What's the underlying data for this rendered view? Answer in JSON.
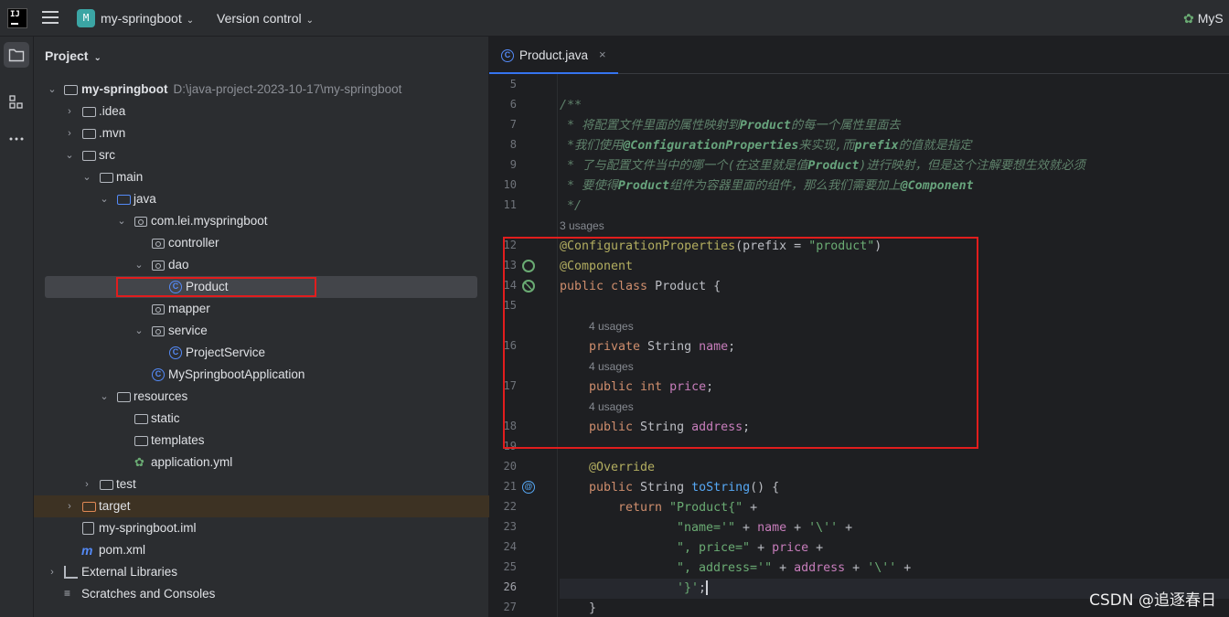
{
  "titlebar": {
    "logo": "IJ",
    "project_badge": "M",
    "project_name": "my-springboot",
    "version_control": "Version control",
    "run_config": "MyS"
  },
  "tool_strip": {
    "items": [
      "folder-icon",
      "structure-icon",
      "more-icon"
    ]
  },
  "project_panel": {
    "header": "Project",
    "tree": [
      {
        "label": "my-springboot",
        "path": "D:\\java-project-2023-10-17\\my-springboot",
        "icon": "module-folder-icon",
        "expanded": true
      },
      {
        "label": ".idea",
        "icon": "folder-icon",
        "expanded": false
      },
      {
        "label": ".mvn",
        "icon": "folder-icon",
        "expanded": false
      },
      {
        "label": "src",
        "icon": "folder-icon",
        "expanded": true
      },
      {
        "label": "main",
        "icon": "folder-icon",
        "expanded": true
      },
      {
        "label": "java",
        "icon": "source-folder-icon",
        "expanded": true
      },
      {
        "label": "com.lei.myspringboot",
        "icon": "package-icon",
        "expanded": true
      },
      {
        "label": "controller",
        "icon": "package-icon"
      },
      {
        "label": "dao",
        "icon": "package-icon",
        "expanded": true
      },
      {
        "label": "Product",
        "icon": "class-icon"
      },
      {
        "label": "mapper",
        "icon": "package-icon"
      },
      {
        "label": "service",
        "icon": "package-icon",
        "expanded": true
      },
      {
        "label": "ProjectService",
        "icon": "class-icon"
      },
      {
        "label": "MySpringbootApplication",
        "icon": "spring-class-icon"
      },
      {
        "label": "resources",
        "icon": "resources-folder-icon",
        "expanded": true
      },
      {
        "label": "static",
        "icon": "folder-icon"
      },
      {
        "label": "templates",
        "icon": "folder-icon"
      },
      {
        "label": "application.yml",
        "icon": "spring-yml-icon"
      },
      {
        "label": "test",
        "icon": "folder-icon",
        "expanded": false
      },
      {
        "label": "target",
        "icon": "excluded-folder-icon",
        "expanded": false
      },
      {
        "label": "my-springboot.iml",
        "icon": "iml-file-icon"
      },
      {
        "label": "pom.xml",
        "icon": "maven-icon"
      },
      {
        "label": "External Libraries",
        "icon": "libraries-icon",
        "expanded": false
      },
      {
        "label": "Scratches and Consoles",
        "icon": "scratches-icon"
      }
    ]
  },
  "editor": {
    "tab": {
      "title": "Product.java",
      "close": "×"
    },
    "line_numbers": [
      "5",
      "6",
      "7",
      "8",
      "9",
      "10",
      "11",
      "12",
      "13",
      "14",
      "15",
      "16",
      "17",
      "18",
      "19",
      "20",
      "21",
      "22",
      "23",
      "24",
      "25",
      "26",
      "27"
    ],
    "hints": {
      "class_usages": "3 usages",
      "name_usages": "4 usages",
      "price_usages": "4 usages",
      "address_usages": "4 usages"
    },
    "code": {
      "l6": "/**",
      "l7a": " * 将配置文件里面的属性映射到",
      "l7b": "Product",
      "l7c": "的每一个属性里面去",
      "l8a": " *我们使用",
      "l8b": "@ConfigurationProperties",
      "l8c": "来实现,而",
      "l8d": "prefix",
      "l8e": "的值就是指定",
      "l9a": " * 了与配置文件当中的哪一个(在这里就是值",
      "l9b": "Product",
      "l9c": ")进行映射，但是这个注解要想生效就必须",
      "l10a": " * 要使得",
      "l10b": "Product",
      "l10c": "组件为容器里面的组件，那么我们需要加上",
      "l10d": "@Component",
      "l11": " */",
      "l12a": "@ConfigurationProperties",
      "l12b": "(prefix = ",
      "l12c": "\"product\"",
      "l12d": ")",
      "l13": "@Component",
      "l14a": "public class ",
      "l14b": "Product {",
      "l16a": "private ",
      "l16b": "String ",
      "l16c": "name",
      "l16d": ";",
      "l17a": "public int ",
      "l17b": "price",
      "l17c": ";",
      "l18a": "public ",
      "l18b": "String ",
      "l18c": "address",
      "l18d": ";",
      "l20": "@Override",
      "l21a": "public ",
      "l21b": "String ",
      "l21c": "toString",
      "l21d": "() {",
      "l22a": "return ",
      "l22b": "\"Product{\"",
      "l22c": " +",
      "l23a": "\"name='\"",
      "l23b": " + ",
      "l23c": "name",
      "l23d": " + ",
      "l23e": "'\\''",
      "l23f": " +",
      "l24a": "\", price=\"",
      "l24b": " + ",
      "l24c": "price",
      "l24d": " +",
      "l25a": "\", address='\"",
      "l25b": " + ",
      "l25c": "address",
      "l25d": " + ",
      "l25e": "'\\''",
      "l25f": " +",
      "l26a": "'}'",
      "l26b": ";",
      "l27": "}"
    }
  },
  "watermark": "CSDN @追逐春日",
  "colors": {
    "accent": "#3574f0",
    "highlight_box": "#e11d1d",
    "comment": "#5f826b",
    "annotation": "#b3ae60",
    "keyword": "#cf8e6d",
    "string": "#6aab73",
    "field": "#c77dbb",
    "method": "#56a8f5"
  }
}
